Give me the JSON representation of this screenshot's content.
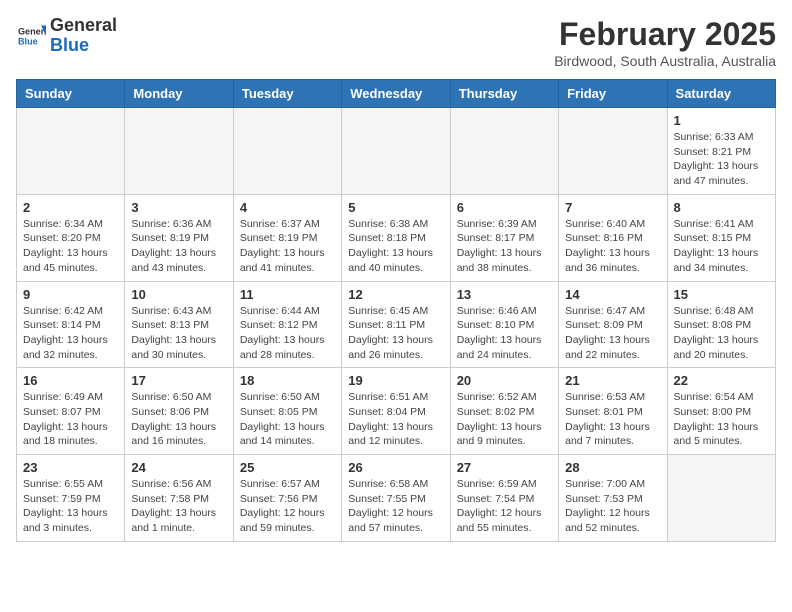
{
  "logo": {
    "general": "General",
    "blue": "Blue"
  },
  "title": "February 2025",
  "subtitle": "Birdwood, South Australia, Australia",
  "headers": [
    "Sunday",
    "Monday",
    "Tuesday",
    "Wednesday",
    "Thursday",
    "Friday",
    "Saturday"
  ],
  "weeks": [
    [
      {
        "day": "",
        "info": ""
      },
      {
        "day": "",
        "info": ""
      },
      {
        "day": "",
        "info": ""
      },
      {
        "day": "",
        "info": ""
      },
      {
        "day": "",
        "info": ""
      },
      {
        "day": "",
        "info": ""
      },
      {
        "day": "1",
        "info": "Sunrise: 6:33 AM\nSunset: 8:21 PM\nDaylight: 13 hours and 47 minutes."
      }
    ],
    [
      {
        "day": "2",
        "info": "Sunrise: 6:34 AM\nSunset: 8:20 PM\nDaylight: 13 hours and 45 minutes."
      },
      {
        "day": "3",
        "info": "Sunrise: 6:36 AM\nSunset: 8:19 PM\nDaylight: 13 hours and 43 minutes."
      },
      {
        "day": "4",
        "info": "Sunrise: 6:37 AM\nSunset: 8:19 PM\nDaylight: 13 hours and 41 minutes."
      },
      {
        "day": "5",
        "info": "Sunrise: 6:38 AM\nSunset: 8:18 PM\nDaylight: 13 hours and 40 minutes."
      },
      {
        "day": "6",
        "info": "Sunrise: 6:39 AM\nSunset: 8:17 PM\nDaylight: 13 hours and 38 minutes."
      },
      {
        "day": "7",
        "info": "Sunrise: 6:40 AM\nSunset: 8:16 PM\nDaylight: 13 hours and 36 minutes."
      },
      {
        "day": "8",
        "info": "Sunrise: 6:41 AM\nSunset: 8:15 PM\nDaylight: 13 hours and 34 minutes."
      }
    ],
    [
      {
        "day": "9",
        "info": "Sunrise: 6:42 AM\nSunset: 8:14 PM\nDaylight: 13 hours and 32 minutes."
      },
      {
        "day": "10",
        "info": "Sunrise: 6:43 AM\nSunset: 8:13 PM\nDaylight: 13 hours and 30 minutes."
      },
      {
        "day": "11",
        "info": "Sunrise: 6:44 AM\nSunset: 8:12 PM\nDaylight: 13 hours and 28 minutes."
      },
      {
        "day": "12",
        "info": "Sunrise: 6:45 AM\nSunset: 8:11 PM\nDaylight: 13 hours and 26 minutes."
      },
      {
        "day": "13",
        "info": "Sunrise: 6:46 AM\nSunset: 8:10 PM\nDaylight: 13 hours and 24 minutes."
      },
      {
        "day": "14",
        "info": "Sunrise: 6:47 AM\nSunset: 8:09 PM\nDaylight: 13 hours and 22 minutes."
      },
      {
        "day": "15",
        "info": "Sunrise: 6:48 AM\nSunset: 8:08 PM\nDaylight: 13 hours and 20 minutes."
      }
    ],
    [
      {
        "day": "16",
        "info": "Sunrise: 6:49 AM\nSunset: 8:07 PM\nDaylight: 13 hours and 18 minutes."
      },
      {
        "day": "17",
        "info": "Sunrise: 6:50 AM\nSunset: 8:06 PM\nDaylight: 13 hours and 16 minutes."
      },
      {
        "day": "18",
        "info": "Sunrise: 6:50 AM\nSunset: 8:05 PM\nDaylight: 13 hours and 14 minutes."
      },
      {
        "day": "19",
        "info": "Sunrise: 6:51 AM\nSunset: 8:04 PM\nDaylight: 13 hours and 12 minutes."
      },
      {
        "day": "20",
        "info": "Sunrise: 6:52 AM\nSunset: 8:02 PM\nDaylight: 13 hours and 9 minutes."
      },
      {
        "day": "21",
        "info": "Sunrise: 6:53 AM\nSunset: 8:01 PM\nDaylight: 13 hours and 7 minutes."
      },
      {
        "day": "22",
        "info": "Sunrise: 6:54 AM\nSunset: 8:00 PM\nDaylight: 13 hours and 5 minutes."
      }
    ],
    [
      {
        "day": "23",
        "info": "Sunrise: 6:55 AM\nSunset: 7:59 PM\nDaylight: 13 hours and 3 minutes."
      },
      {
        "day": "24",
        "info": "Sunrise: 6:56 AM\nSunset: 7:58 PM\nDaylight: 13 hours and 1 minute."
      },
      {
        "day": "25",
        "info": "Sunrise: 6:57 AM\nSunset: 7:56 PM\nDaylight: 12 hours and 59 minutes."
      },
      {
        "day": "26",
        "info": "Sunrise: 6:58 AM\nSunset: 7:55 PM\nDaylight: 12 hours and 57 minutes."
      },
      {
        "day": "27",
        "info": "Sunrise: 6:59 AM\nSunset: 7:54 PM\nDaylight: 12 hours and 55 minutes."
      },
      {
        "day": "28",
        "info": "Sunrise: 7:00 AM\nSunset: 7:53 PM\nDaylight: 12 hours and 52 minutes."
      },
      {
        "day": "",
        "info": ""
      }
    ]
  ]
}
